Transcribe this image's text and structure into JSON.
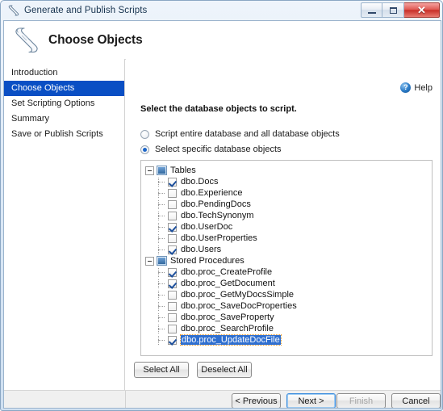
{
  "window": {
    "title": "Generate and Publish Scripts",
    "title_icon": "script-scroll-icon",
    "controls": {
      "minimize": "minimize-icon",
      "maximize": "maximize-icon",
      "close": "✕"
    }
  },
  "header": {
    "icon": "script-scroll-icon",
    "title": "Choose Objects"
  },
  "sidebar": {
    "items": [
      {
        "label": "Introduction",
        "active": false
      },
      {
        "label": "Choose Objects",
        "active": true
      },
      {
        "label": "Set Scripting Options",
        "active": false
      },
      {
        "label": "Summary",
        "active": false
      },
      {
        "label": "Save or Publish Scripts",
        "active": false
      }
    ]
  },
  "main": {
    "help": {
      "label": "Help",
      "icon_glyph": "?"
    },
    "instruction": "Select the database objects to script.",
    "radios": [
      {
        "label": "Script entire database and all database objects",
        "checked": false
      },
      {
        "label": "Select specific database objects",
        "checked": true
      }
    ],
    "tree": [
      {
        "label": "Tables",
        "expanded": true,
        "children": [
          {
            "label": "dbo.Docs",
            "checked": true,
            "selected": false
          },
          {
            "label": "dbo.Experience",
            "checked": false,
            "selected": false
          },
          {
            "label": "dbo.PendingDocs",
            "checked": false,
            "selected": false
          },
          {
            "label": "dbo.TechSynonym",
            "checked": false,
            "selected": false
          },
          {
            "label": "dbo.UserDoc",
            "checked": true,
            "selected": false
          },
          {
            "label": "dbo.UserProperties",
            "checked": false,
            "selected": false
          },
          {
            "label": "dbo.Users",
            "checked": true,
            "selected": false
          }
        ]
      },
      {
        "label": "Stored Procedures",
        "expanded": true,
        "children": [
          {
            "label": "dbo.proc_CreateProfile",
            "checked": true,
            "selected": false
          },
          {
            "label": "dbo.proc_GetDocument",
            "checked": true,
            "selected": false
          },
          {
            "label": "dbo.proc_GetMyDocsSimple",
            "checked": false,
            "selected": false
          },
          {
            "label": "dbo.proc_SaveDocProperties",
            "checked": false,
            "selected": false
          },
          {
            "label": "dbo.proc_SaveProperty",
            "checked": false,
            "selected": false
          },
          {
            "label": "dbo.proc_SearchProfile",
            "checked": false,
            "selected": false
          },
          {
            "label": "dbo.proc_UpdateDocFile",
            "checked": true,
            "selected": true
          }
        ]
      }
    ],
    "select_all_label": "Select All",
    "deselect_all_label": "Deselect All"
  },
  "footer": {
    "previous_label": "< Previous",
    "next_label": "Next >",
    "finish_label": "Finish",
    "cancel_label": "Cancel",
    "next_focused": true,
    "finish_disabled": true
  },
  "colors": {
    "selection_blue": "#0a4fc4",
    "tree_selection_blue": "#2f6fd0",
    "selection_outline": "#f0a030",
    "close_red": "#c83028",
    "focus_blue": "#3c8dde"
  }
}
